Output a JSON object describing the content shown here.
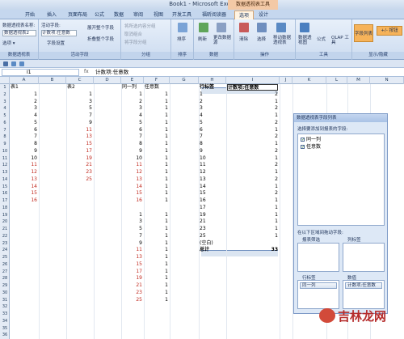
{
  "window": {
    "title": "Book1 - Microsoft Excel",
    "context_tab": "数据透视表工具"
  },
  "tabs": [
    "开始",
    "插入",
    "页面布局",
    "公式",
    "数据",
    "审阅",
    "视图",
    "开发工具",
    "福昕阅读器",
    "选项",
    "设计"
  ],
  "active_tab": "选项",
  "ribbon": {
    "groups": [
      {
        "label": "数据透视表",
        "items": [
          "数据透视表名称:",
          "数据透视表2",
          "选项 ▾"
        ]
      },
      {
        "label": "活动字段",
        "items": [
          "活动字段:",
          "计数项:任意数",
          "字段设置",
          "展开整个字段",
          "折叠整个字段"
        ]
      },
      {
        "label": "分组",
        "items": [
          "将所选内容分组",
          "取消组合",
          "将字段分组"
        ]
      },
      {
        "label": "排序",
        "items": [
          "排序"
        ]
      },
      {
        "label": "数据",
        "items": [
          "刷新",
          "更改数据源"
        ]
      },
      {
        "label": "操作",
        "items": [
          "清除",
          "选择",
          "移动数据透视表"
        ]
      },
      {
        "label": "工具",
        "items": [
          "数据透视图",
          "公式",
          "OLAP 工具"
        ]
      },
      {
        "label": "显示/隐藏",
        "items": [
          "字段列表",
          "+/- 按钮"
        ]
      }
    ]
  },
  "formula_bar": {
    "name_box": "I1",
    "fx": "fx",
    "value": "计数项:任意数"
  },
  "columns": [
    "A",
    "B",
    "C",
    "D",
    "E",
    "F",
    "G",
    "H",
    "I",
    "J",
    "K",
    "L",
    "M",
    "N"
  ],
  "rows": [
    "1",
    "2",
    "3",
    "4",
    "5",
    "6",
    "7",
    "8",
    "9",
    "10",
    "11",
    "12",
    "13",
    "14",
    "15",
    "16",
    "17",
    "18",
    "19",
    "20",
    "21",
    "22",
    "23",
    "24",
    "25",
    "26",
    "27",
    "28",
    "29",
    "30",
    "31",
    "32",
    "33",
    "34",
    "35",
    "36"
  ],
  "sheet": {
    "a_header": "表1",
    "a_values": [
      "1",
      "2",
      "3",
      "4",
      "5",
      "6",
      "7",
      "8",
      "9",
      "10",
      "11",
      "12",
      "13",
      "14",
      "15",
      "16"
    ],
    "c_header": "表2",
    "c_values": [
      "1",
      "3",
      "5",
      "7",
      "9",
      "11",
      "13",
      "15",
      "17",
      "19",
      "21",
      "23",
      "25"
    ],
    "e_header": "同一列",
    "e_values": [
      "1",
      "2",
      "3",
      "4",
      "5",
      "6",
      "7",
      "8",
      "9",
      "10",
      "11",
      "12",
      "13",
      "14",
      "15",
      "16",
      "",
      "1",
      "3",
      "5",
      "7",
      "9",
      "11",
      "13",
      "15",
      "17",
      "19",
      "21",
      "23",
      "25"
    ],
    "f_header": "任意数",
    "f_values": [
      "1",
      "1",
      "1",
      "1",
      "1",
      "1",
      "1",
      "1",
      "1",
      "1",
      "1",
      "1",
      "1",
      "1",
      "1",
      "1",
      "",
      "1",
      "1",
      "1",
      "1",
      "1",
      "1",
      "1",
      "1",
      "1",
      "1",
      "1",
      "1",
      "1"
    ]
  },
  "pivot": {
    "row_header": "行标签",
    "value_header": "计数项:任意数",
    "labels": [
      "1",
      "2",
      "3",
      "4",
      "5",
      "6",
      "7",
      "8",
      "9",
      "10",
      "11",
      "12",
      "13",
      "14",
      "15",
      "16",
      "17",
      "19",
      "21",
      "23",
      "25",
      "(空白)"
    ],
    "counts": [
      "2",
      "1",
      "2",
      "1",
      "2",
      "1",
      "2",
      "1",
      "2",
      "1",
      "2",
      "1",
      "2",
      "1",
      "2",
      "1",
      "1",
      "1",
      "1",
      "1",
      "1",
      ""
    ],
    "total_label": "总计",
    "total_value": "33"
  },
  "field_list": {
    "title": "数据透视表字段列表",
    "choose_label": "选择要添加到报表的字段:",
    "fields": [
      {
        "name": "同一列",
        "checked": true
      },
      {
        "name": "任意数",
        "checked": true
      }
    ],
    "drag_label": "在以下区域间拖动字段:",
    "report_filter": "报表筛选",
    "column_labels": "列标签",
    "row_labels": "行标签",
    "values": "数值",
    "row_field": "同一列",
    "value_field": "计数项:任意数"
  },
  "watermark": "吉林龙网",
  "colors": {
    "ribbon_bg": "#d9e6f6",
    "accent": "#f3c9a6",
    "red_text": "#c0281e",
    "pivot_header": "#dbe5f1"
  }
}
